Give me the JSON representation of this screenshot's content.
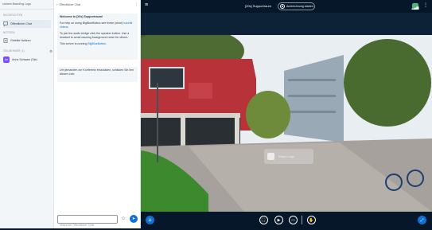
{
  "userlist": {
    "branding": "custom Branding Logo",
    "messages_heading": "NACHRICHTEN",
    "public_chat": "Öffentlicher Chat",
    "notes_heading": "NOTIZEN",
    "shared_notes": "Geteilte Notizen",
    "users_heading": "TEILNEHMER (1)",
    "user": {
      "initials": "An",
      "name": "Anna Schwarz (Sie)"
    }
  },
  "chat": {
    "title": "Öffentlicher Chat",
    "welcome": {
      "title": "Welcome to [20s] Supportraum!",
      "para1_prefix": "For help on using BigBlueButton see these (short) ",
      "para1_link": "tutorial videos",
      "para1_suffix": ".",
      "para2": "To join the audio bridge click the speaker button. Use a headset to avoid causing background noise for others.",
      "para3_prefix": "This server is running ",
      "para3_link": "BigBlueButton",
      "para3_suffix": "."
    },
    "invite": {
      "text": "Um jemanden zur Konferenz einzuladen, schicken Sie ihm diesen Link:",
      "link": "https://..."
    },
    "input_placeholder": "Nachricht Öffentlicher Chat"
  },
  "header": {
    "room_title": "[20s] Supportraum",
    "record_label": "Aufzeichnung starten"
  },
  "watermark": {
    "text": "Vitapin Logo"
  },
  "colors": {
    "accent": "#0f70d7",
    "nav_bg": "#06172a",
    "connection": "#4cb579",
    "avatar": "#7c4dff"
  },
  "icons": {
    "menu": "hamburger-icon",
    "record": "record-icon",
    "connection": "connection-status-icon",
    "options": "kebab-icon",
    "actions": "plus-icon",
    "audio": "headset-icon",
    "video": "camera-icon",
    "screenshare": "desktop-share-icon",
    "raise_hand": "hand-icon",
    "fullscreen": "fullscreen-icon"
  }
}
